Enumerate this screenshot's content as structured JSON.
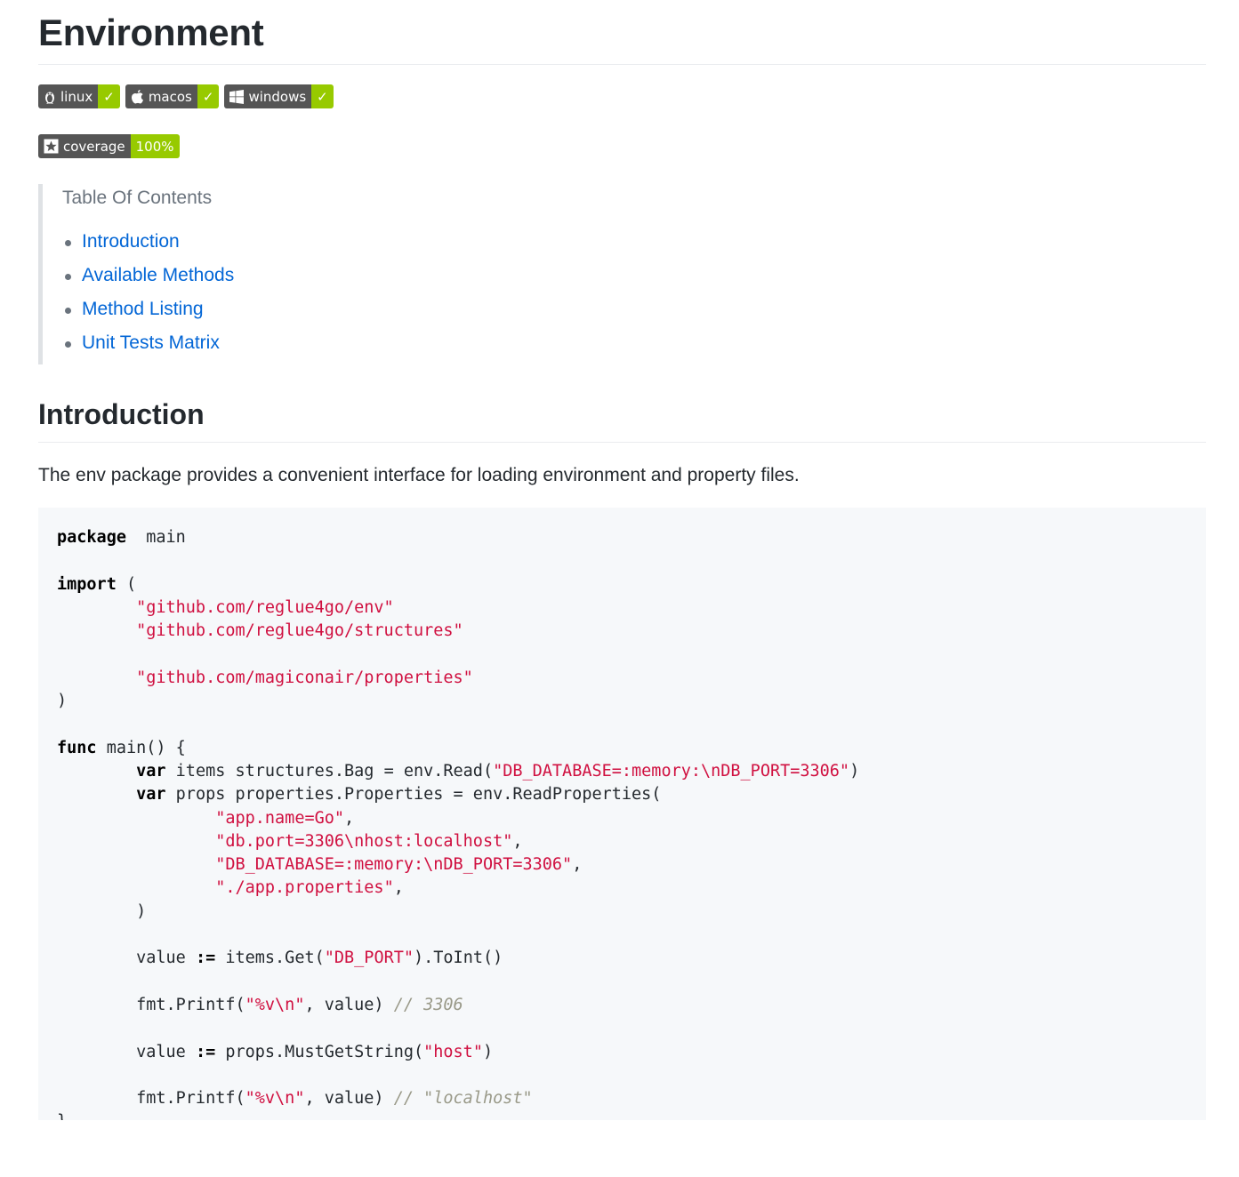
{
  "page": {
    "title": "Environment"
  },
  "badges": {
    "os": [
      {
        "icon": "linux-icon",
        "label": "linux",
        "status": "✓"
      },
      {
        "icon": "apple-icon",
        "label": "macos",
        "status": "✓"
      },
      {
        "icon": "windows-icon",
        "label": "windows",
        "status": "✓"
      }
    ],
    "coverage": {
      "icon": "star-icon",
      "label": "coverage",
      "value": "100%"
    }
  },
  "colors": {
    "badge_left": "#555555",
    "badge_right": "#97ca00",
    "link": "#0366d6",
    "string": "#d01040",
    "comment": "#999988",
    "code_bg": "#f6f8fa"
  },
  "toc": {
    "title": "Table Of Contents",
    "items": [
      {
        "label": "Introduction"
      },
      {
        "label": "Available Methods"
      },
      {
        "label": "Method Listing"
      },
      {
        "label": "Unit Tests Matrix"
      }
    ]
  },
  "introduction": {
    "heading": "Introduction",
    "description": "The env package provides a convenient interface for loading environment and property files."
  },
  "code": {
    "language": "go",
    "lines": [
      [
        [
          "kw",
          "package"
        ],
        [
          "",
          "  main"
        ]
      ],
      [],
      [
        [
          "kw",
          "import"
        ],
        [
          "",
          " ("
        ]
      ],
      [
        [
          "",
          "        "
        ],
        [
          "str",
          "\"github.com/reglue4go/env\""
        ]
      ],
      [
        [
          "",
          "        "
        ],
        [
          "str",
          "\"github.com/reglue4go/structures\""
        ]
      ],
      [],
      [
        [
          "",
          "        "
        ],
        [
          "str",
          "\"github.com/magiconair/properties\""
        ]
      ],
      [
        [
          "",
          ")"
        ]
      ],
      [],
      [
        [
          "kw",
          "func"
        ],
        [
          "",
          " main() {"
        ]
      ],
      [
        [
          "",
          "        "
        ],
        [
          "kw",
          "var"
        ],
        [
          "",
          " items structures.Bag = env.Read("
        ],
        [
          "str",
          "\"DB_DATABASE=:memory:\\nDB_PORT=3306\""
        ],
        [
          "",
          ")"
        ]
      ],
      [
        [
          "",
          "        "
        ],
        [
          "kw",
          "var"
        ],
        [
          "",
          " props properties.Properties = env.ReadProperties("
        ]
      ],
      [
        [
          "",
          "                "
        ],
        [
          "str",
          "\"app.name=Go\""
        ],
        [
          "",
          ","
        ]
      ],
      [
        [
          "",
          "                "
        ],
        [
          "str",
          "\"db.port=3306\\nhost:localhost\""
        ],
        [
          "",
          ","
        ]
      ],
      [
        [
          "",
          "                "
        ],
        [
          "str",
          "\"DB_DATABASE=:memory:\\nDB_PORT=3306\""
        ],
        [
          "",
          ","
        ]
      ],
      [
        [
          "",
          "                "
        ],
        [
          "str",
          "\"./app.properties\""
        ],
        [
          "",
          ","
        ]
      ],
      [
        [
          "",
          "        )"
        ]
      ],
      [],
      [
        [
          "",
          "        value "
        ],
        [
          "kw",
          ":="
        ],
        [
          "",
          " items.Get("
        ],
        [
          "str",
          "\"DB_PORT\""
        ],
        [
          "",
          ").ToInt()"
        ]
      ],
      [],
      [
        [
          "",
          "        fmt.Printf("
        ],
        [
          "str",
          "\"%v\\n\""
        ],
        [
          "",
          ", value) "
        ],
        [
          "cm",
          "// 3306"
        ]
      ],
      [],
      [
        [
          "",
          "        value "
        ],
        [
          "kw",
          ":="
        ],
        [
          "",
          " props.MustGetString("
        ],
        [
          "str",
          "\"host\""
        ],
        [
          "",
          ")"
        ]
      ],
      [],
      [
        [
          "",
          "        fmt.Printf("
        ],
        [
          "str",
          "\"%v\\n\""
        ],
        [
          "",
          ", value) "
        ],
        [
          "cm",
          "// \"localhost\""
        ]
      ],
      [
        [
          "",
          "}"
        ]
      ]
    ]
  }
}
